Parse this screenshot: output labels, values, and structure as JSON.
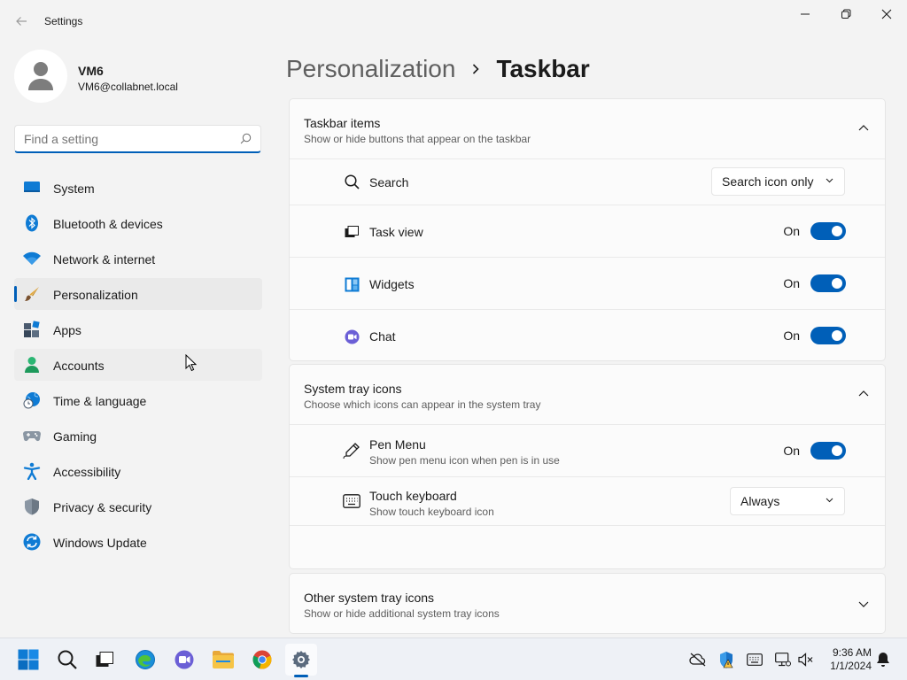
{
  "window": {
    "title": "Settings"
  },
  "user": {
    "name": "VM6",
    "email": "VM6@collabnet.local"
  },
  "search": {
    "placeholder": "Find a setting"
  },
  "nav": [
    {
      "label": "System",
      "icon": "system-icon"
    },
    {
      "label": "Bluetooth & devices",
      "icon": "bluetooth-icon"
    },
    {
      "label": "Network & internet",
      "icon": "wifi-icon"
    },
    {
      "label": "Personalization",
      "icon": "brush-icon",
      "selected": true
    },
    {
      "label": "Apps",
      "icon": "apps-icon"
    },
    {
      "label": "Accounts",
      "icon": "accounts-icon",
      "hovered": true
    },
    {
      "label": "Time & language",
      "icon": "globe-clock-icon"
    },
    {
      "label": "Gaming",
      "icon": "gamepad-icon"
    },
    {
      "label": "Accessibility",
      "icon": "accessibility-icon"
    },
    {
      "label": "Privacy & security",
      "icon": "shield-icon"
    },
    {
      "label": "Windows Update",
      "icon": "update-icon"
    }
  ],
  "breadcrumb": {
    "parent": "Personalization",
    "current": "Taskbar"
  },
  "taskbar_items": {
    "title": "Taskbar items",
    "subtitle": "Show or hide buttons that appear on the taskbar",
    "search": {
      "label": "Search",
      "value": "Search icon only"
    },
    "task_view": {
      "label": "Task view",
      "state": "On"
    },
    "widgets": {
      "label": "Widgets",
      "state": "On"
    },
    "chat": {
      "label": "Chat",
      "state": "On"
    }
  },
  "system_tray": {
    "title": "System tray icons",
    "subtitle": "Choose which icons can appear in the system tray",
    "pen_menu": {
      "label": "Pen Menu",
      "sub": "Show pen menu icon when pen is in use",
      "state": "On"
    },
    "touch_keyboard": {
      "label": "Touch keyboard",
      "sub": "Show touch keyboard icon",
      "value": "Always"
    }
  },
  "other_tray": {
    "title": "Other system tray icons",
    "subtitle": "Show or hide additional system tray icons"
  },
  "clock": {
    "time": "9:36 AM",
    "date": "1/1/2024"
  },
  "colors": {
    "accent": "#005fb8",
    "background": "#f3f3f3",
    "card": "#fbfbfb"
  }
}
